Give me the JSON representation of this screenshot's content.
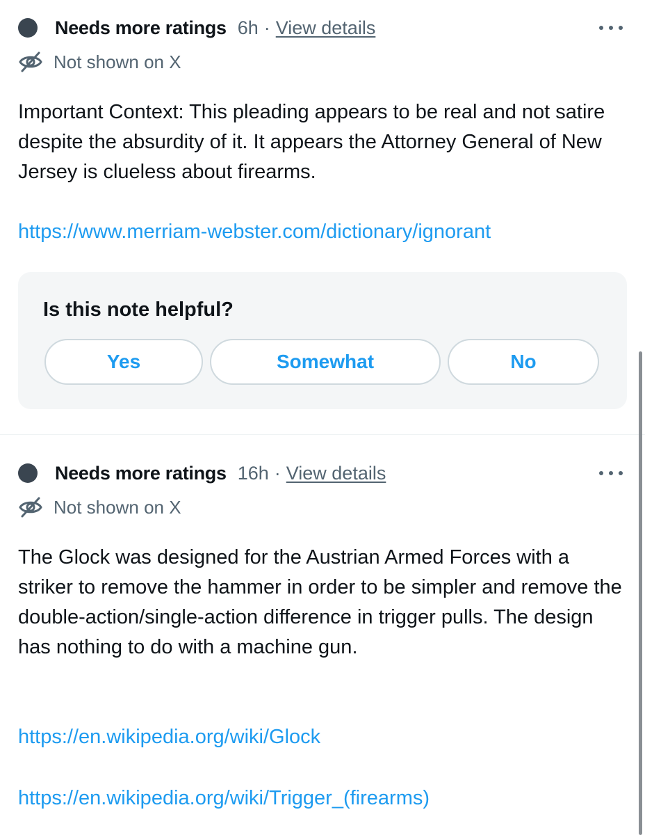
{
  "notes": [
    {
      "status": "Needs more ratings",
      "time": "6h",
      "separator": "·",
      "details_link": "View details",
      "visibility": "Not shown on X",
      "text": "Important Context:  This pleading appears to be real and not satire despite the absurdity of it.  It appears the Attorney General of New Jersey is clueless about firearms.",
      "links": [
        "https://www.merriam-webster.com/dictionary/ignorant"
      ]
    },
    {
      "status": "Needs more ratings",
      "time": "16h",
      "separator": "·",
      "details_link": "View details",
      "visibility": "Not shown on X",
      "text": "The Glock was designed for the Austrian Armed Forces with a striker to remove the hammer in order to be simpler and remove the double-action/single-action difference in trigger pulls. The design has nothing to do with a machine gun.",
      "links": [
        "https://en.wikipedia.org/wiki/Glock",
        "https://en.wikipedia.org/wiki/Trigger_(firearms)"
      ]
    }
  ],
  "rating_panel": {
    "question": "Is this note helpful?",
    "options": [
      "Yes",
      "Somewhat",
      "No"
    ]
  },
  "icons": {
    "status": "status-dot-icon",
    "more": "more-horizontal-icon",
    "visibility": "eye-off-icon"
  },
  "colors": {
    "accent": "#1d9bf0",
    "secondary_text": "#536471",
    "primary_text": "#0f1419",
    "status_dot": "#3a4550",
    "panel_bg": "#f4f6f7",
    "border": "#cfd9de"
  }
}
